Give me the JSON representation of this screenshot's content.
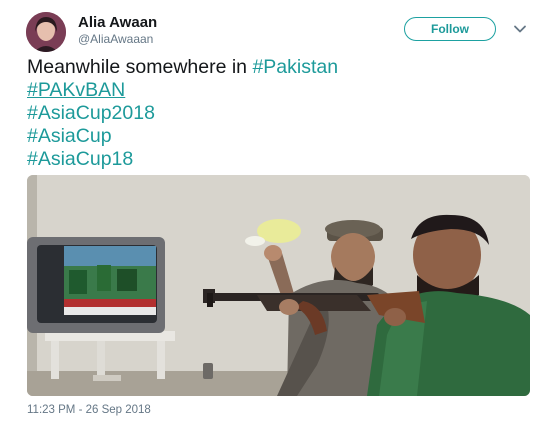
{
  "author": {
    "display_name": "Alia Awaan",
    "handle": "@AliaAwaaan",
    "avatar_icon": "profile-photo"
  },
  "follow_label": "Follow",
  "caret_icon": "chevron-down-icon",
  "tweet": {
    "text_prefix": "Meanwhile somewhere in ",
    "hashtags": [
      "#Pakistan",
      "#PAKvBAN",
      "#AsiaCup2018",
      "#AsiaCup",
      "#AsiaCup18"
    ]
  },
  "media": {
    "description_icon": "photo-men-with-rifles-watching-tv",
    "tv_icon": "tv-icon",
    "rifle_icon": "rifle-icon"
  },
  "timestamp": "11:23 PM - 26 Sep 2018",
  "colors": {
    "accent": "#1d9a9a",
    "text": "#14171a",
    "secondary": "#657786"
  }
}
